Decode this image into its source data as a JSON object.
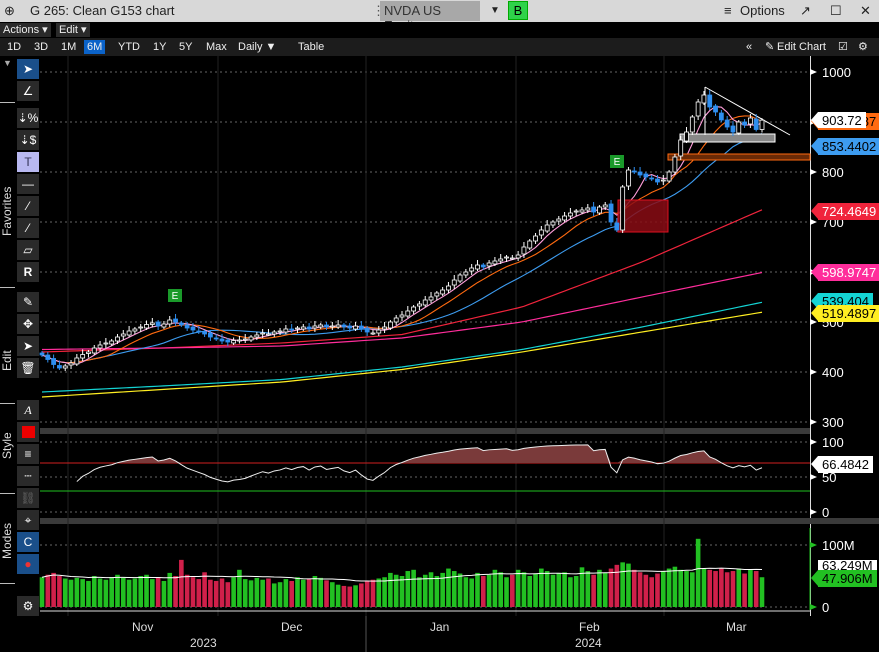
{
  "window": {
    "title": "G 265: Clean G153 chart",
    "security": "NVDA US Equity",
    "security_button": "B",
    "options": "Options"
  },
  "menu": {
    "actions": "Actions",
    "edit": "Edit"
  },
  "ranges": [
    "1D",
    "3D",
    "1M",
    "6M",
    "YTD",
    "1Y",
    "5Y",
    "Max"
  ],
  "active_range": "6M",
  "frequency": "Daily ▼",
  "table": "Table",
  "edit_chart": "Edit Chart",
  "side_labels": {
    "favorites": "Favorites",
    "edit": "Edit",
    "style": "Style",
    "modes": "Modes"
  },
  "colors": {
    "up": "#ffffff",
    "down": "#2f8ff0",
    "vol_up": "#22c022",
    "vol_down": "#d0204a"
  },
  "chart_data": {
    "type": "candlestick",
    "price_axis": {
      "ticks": [
        300,
        400,
        500,
        600,
        700,
        800,
        900,
        1000
      ],
      "range": [
        290,
        1010
      ]
    },
    "closes": [
      434,
      425,
      415,
      408,
      412,
      418,
      428,
      435,
      440,
      448,
      454,
      458,
      462,
      470,
      476,
      482,
      486,
      490,
      495,
      498,
      492,
      496,
      504,
      500,
      494,
      488,
      484,
      480,
      476,
      470,
      466,
      462,
      460,
      463,
      464,
      466,
      470,
      474,
      478,
      476,
      480,
      482,
      486,
      484,
      488,
      490,
      486,
      492,
      494,
      490,
      492,
      494,
      490,
      488,
      492,
      486,
      480,
      478,
      484,
      490,
      500,
      508,
      514,
      522,
      530,
      536,
      544,
      550,
      558,
      564,
      572,
      584,
      594,
      600,
      608,
      614,
      610,
      618,
      622,
      626,
      630,
      628,
      634,
      650,
      662,
      672,
      684,
      694,
      700,
      706,
      712,
      718,
      722,
      724,
      728,
      720,
      730,
      734,
      700,
      684,
      770,
      804,
      800,
      794,
      790,
      786,
      780,
      784,
      800,
      830,
      864,
      880,
      910,
      940,
      954,
      930,
      920,
      904,
      890,
      880,
      900,
      894,
      908,
      885,
      903.72
    ],
    "volumes_m": [
      48,
      52,
      55,
      50,
      46,
      44,
      47,
      45,
      42,
      50,
      46,
      44,
      48,
      52,
      47,
      44,
      46,
      50,
      52,
      45,
      48,
      42,
      55,
      50,
      76,
      52,
      48,
      45,
      56,
      44,
      42,
      46,
      40,
      48,
      60,
      45,
      43,
      47,
      44,
      46,
      38,
      40,
      45,
      42,
      48,
      44,
      46,
      50,
      47,
      43,
      40,
      36,
      34,
      33,
      35,
      38,
      42,
      44,
      46,
      48,
      55,
      52,
      50,
      58,
      60,
      48,
      52,
      56,
      50,
      55,
      62,
      58,
      54,
      48,
      46,
      55,
      50,
      52,
      60,
      56,
      48,
      52,
      60,
      56,
      50,
      54,
      62,
      58,
      52,
      54,
      56,
      48,
      50,
      64,
      58,
      52,
      60,
      55,
      62,
      68,
      72,
      70,
      60,
      56,
      52,
      48,
      54,
      58,
      62,
      65,
      60,
      58,
      56,
      110,
      62,
      60,
      58,
      62,
      56,
      58,
      62,
      54,
      60,
      58,
      48
    ],
    "long_mas": [
      {
        "color": "#ffee22",
        "last": "519.4897",
        "points": [
          350,
          365,
          380,
          405,
          440,
          480,
          519.49
        ]
      },
      {
        "color": "#14d4d4",
        "last": "539.404",
        "points": [
          360,
          372,
          385,
          410,
          445,
          490,
          539.4
        ]
      },
      {
        "color": "#f0243c",
        "last": "724.4649",
        "points": [
          440,
          448,
          458,
          475,
          530,
          620,
          724.46
        ]
      },
      {
        "color": "#ff2d9b",
        "last": "598.9747",
        "points": [
          445,
          448,
          452,
          468,
          500,
          550,
          598.97
        ]
      }
    ],
    "short_mas": [
      {
        "period": 20,
        "color": "#3d9cf0",
        "last": "853.4402"
      },
      {
        "period": 10,
        "color": "#ff6a10",
        "last": "887.6487"
      },
      {
        "period": 5,
        "color": "#ff9edb",
        "last": ""
      }
    ],
    "last_price": "903.72",
    "rsi": {
      "ticks": [
        "100",
        "50",
        "0"
      ],
      "last": "66.4842",
      "upper": 70,
      "lower": 30
    },
    "volume": {
      "ticks": [
        "100M",
        "0"
      ],
      "ma_last": "63.249M",
      "last": "47.906M"
    },
    "earnings_marker": "E",
    "months": [
      "Nov",
      "Dec",
      "Jan",
      "Feb",
      "Mar"
    ],
    "years": [
      "2023",
      "2024"
    ]
  }
}
